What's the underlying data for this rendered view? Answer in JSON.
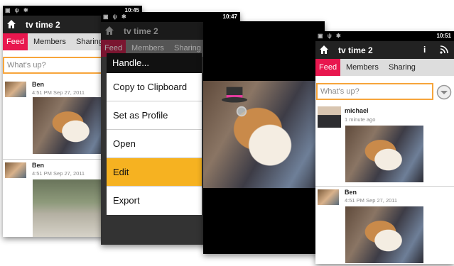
{
  "screen1": {
    "status_time": "10:45",
    "app_title": "tv time 2",
    "tabs": [
      "Feed",
      "Members",
      "Sharing"
    ],
    "search_placeholder": "What's up?",
    "posts": [
      {
        "author": "Ben",
        "meta": "4:51 PM Sep 27, 2011"
      },
      {
        "author": "Ben",
        "meta": "4:51 PM Sep 27, 2011"
      }
    ]
  },
  "screen2": {
    "status_time": "10:47",
    "app_title": "tv time 2",
    "tabs": [
      "Feed",
      "Members",
      "Sharing"
    ],
    "menu": {
      "title": "Handle...",
      "items": [
        "Copy to Clipboard",
        "Set as Profile",
        "Open",
        "Edit",
        "Export"
      ],
      "highlighted": "Edit"
    }
  },
  "screen3": {},
  "screen4": {
    "status_time": "10:51",
    "app_title": "tv time 2",
    "tabs": [
      "Feed",
      "Members",
      "Sharing"
    ],
    "search_placeholder": "What's up?",
    "posts": [
      {
        "author": "michael",
        "meta": "1 minute ago"
      },
      {
        "author": "Ben",
        "meta": "4:51 PM Sep 27, 2011"
      }
    ],
    "icons": {
      "info": "i",
      "rss": "rss-icon"
    }
  },
  "colors": {
    "active_tab": "#e8174e",
    "search_border": "#f7a53b",
    "menu_highlight": "#f6b221"
  }
}
